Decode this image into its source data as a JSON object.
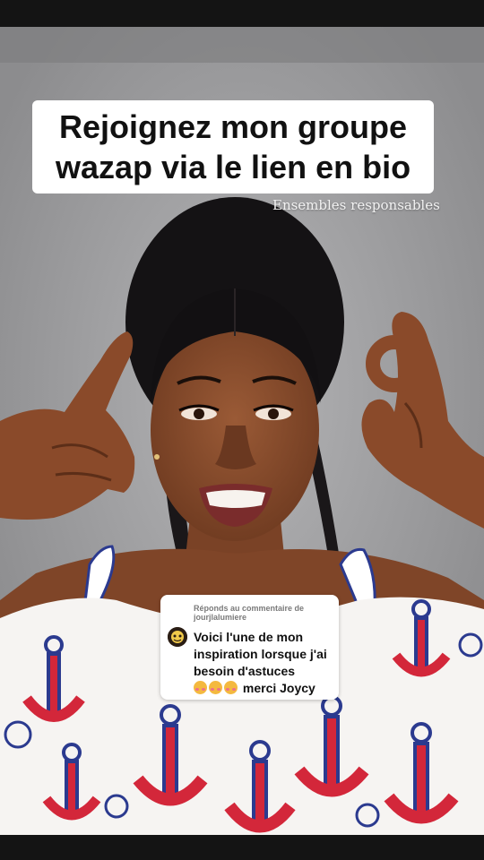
{
  "overlay": {
    "caption": "Rejoignez mon groupe wazap via le lien en bio",
    "subtext": "Ensembles responsables"
  },
  "reply_card": {
    "header": "Réponds au commentaire de jourjlalumiere",
    "comment": "Voici l'une de mon inspiration lorsque j'ai besoin d'astuces",
    "comment_tail": "merci Joycy",
    "emoji_count": 3,
    "emoji_name": "smiling-face-with-hearts"
  },
  "colors": {
    "caption_bg": "#ffffff",
    "caption_text": "#111111",
    "backdrop": "#a4a4a6",
    "dress_accent": "#d3273a",
    "dress_outline": "#2b3a8f"
  }
}
